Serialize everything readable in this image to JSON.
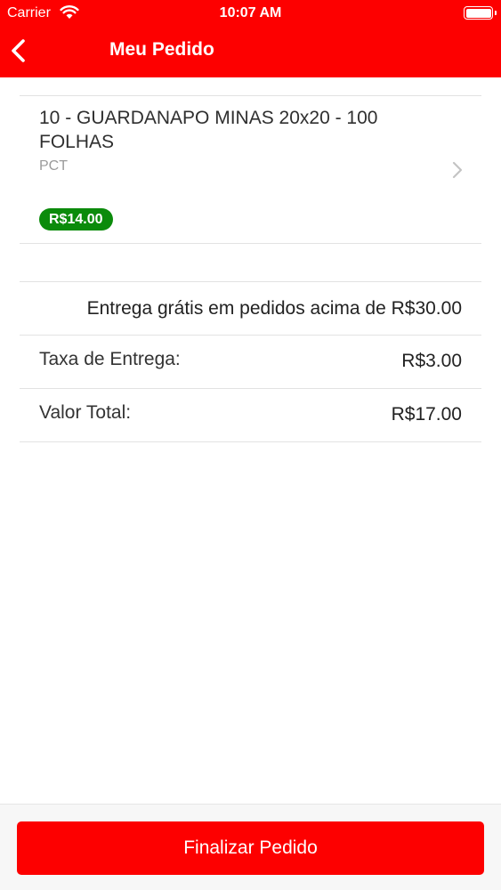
{
  "status_bar": {
    "carrier": "Carrier",
    "time": "10:07 AM"
  },
  "header": {
    "title": "Meu Pedido",
    "back_icon": "chevron-left-icon"
  },
  "cart": {
    "items": [
      {
        "name": "10 - GUARDANAPO MINAS 20x20 - 100 FOLHAS",
        "unit": "PCT",
        "price": "R$14.00"
      }
    ]
  },
  "summary": {
    "free_delivery_note": "Entrega grátis em pedidos acima de R$30.00",
    "delivery_fee_label": "Taxa de Entrega:",
    "delivery_fee_value": "R$3.00",
    "total_label": "Valor Total:",
    "total_value": "R$17.00"
  },
  "footer": {
    "checkout_label": "Finalizar Pedido"
  },
  "colors": {
    "brand": "#fd0000",
    "price_badge": "#0b8b0b"
  }
}
